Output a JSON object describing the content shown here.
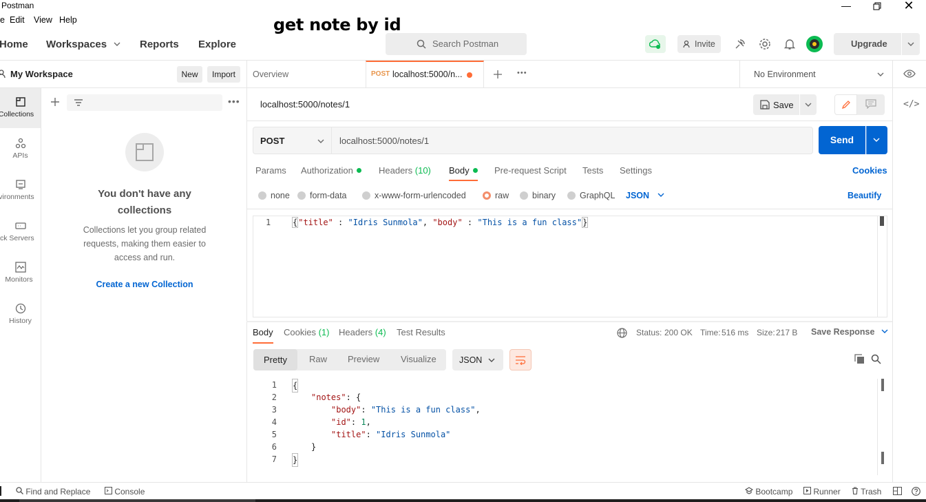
{
  "window": {
    "title": "Postman"
  },
  "menu": {
    "items": [
      "e",
      "Edit",
      "View",
      "Help"
    ]
  },
  "overlay_title": "get note by id",
  "nav": {
    "home": "Home",
    "workspaces": "Workspaces",
    "reports": "Reports",
    "explore": "Explore",
    "search_placeholder": "Search Postman",
    "invite": "Invite",
    "upgrade": "Upgrade"
  },
  "sidebar": {
    "workspace_name": "My Workspace",
    "new_label": "New",
    "import_label": "Import",
    "rail": [
      {
        "label": "Collections",
        "icon": "collections-icon"
      },
      {
        "label": "APIs",
        "icon": "apis-icon"
      },
      {
        "label": "Environments",
        "icon": "environments-icon"
      },
      {
        "label": "Mock Servers",
        "icon": "mock-servers-icon"
      },
      {
        "label": "Monitors",
        "icon": "monitors-icon"
      },
      {
        "label": "History",
        "icon": "history-icon"
      }
    ],
    "empty_title": "You don't have any collections",
    "empty_desc": "Collections let you group related requests, making them easier to access and run.",
    "create_link": "Create a new Collection"
  },
  "tabs": {
    "overview": "Overview",
    "active_method": "POST",
    "active_label": "localhost:5000/n...",
    "environment": "No Environment"
  },
  "request": {
    "title": "localhost:5000/notes/1",
    "save_label": "Save",
    "method": "POST",
    "url": "localhost:5000/notes/1",
    "send_label": "Send",
    "tabs": {
      "params": "Params",
      "authorization": "Authorization",
      "headers": "Headers",
      "headers_count": "(10)",
      "body": "Body",
      "prerequest": "Pre-request Script",
      "tests": "Tests",
      "settings": "Settings",
      "cookies": "Cookies"
    },
    "body_types": [
      "none",
      "form-data",
      "x-www-form-urlencoded",
      "raw",
      "binary",
      "GraphQL"
    ],
    "selected_body_type": "raw",
    "format": "JSON",
    "beautify": "Beautify",
    "body_line_no": "1",
    "body_parts": {
      "open": "{",
      "k1": "\"title\"",
      "colon1": " : ",
      "v1": "\"Idris Sunmola\"",
      "comma": ", ",
      "k2": "\"body\"",
      "colon2": " : ",
      "v2": "\"This is a fun class\"",
      "close": "}"
    }
  },
  "response": {
    "tabs": {
      "body": "Body",
      "cookies": "Cookies",
      "cookies_count": "(1)",
      "headers": "Headers",
      "headers_count": "(4)",
      "test_results": "Test Results"
    },
    "status_label": "Status:",
    "status_value": "200 OK",
    "time_label": "Time:",
    "time_value": "516 ms",
    "size_label": "Size:",
    "size_value": "217 B",
    "save_response": "Save Response",
    "views": [
      "Pretty",
      "Raw",
      "Preview",
      "Visualize"
    ],
    "format": "JSON",
    "lines": [
      {
        "n": "1",
        "text": "{"
      },
      {
        "n": "2",
        "key": "\"notes\"",
        "rest": ": {"
      },
      {
        "n": "3",
        "key": "\"body\"",
        "rest": ": ",
        "val": "\"This is a fun class\"",
        "tail": ","
      },
      {
        "n": "4",
        "key": "\"id\"",
        "rest": ": ",
        "num": "1",
        "tail": ","
      },
      {
        "n": "5",
        "key": "\"title\"",
        "rest": ": ",
        "val": "\"Idris Sunmola\"",
        "tail": ""
      },
      {
        "n": "6",
        "text": "}"
      },
      {
        "n": "7",
        "text": "}"
      }
    ]
  },
  "statusbar": {
    "find_replace": "Find and Replace",
    "console": "Console",
    "bootcamp": "Bootcamp",
    "runner": "Runner",
    "trash": "Trash"
  },
  "colors": {
    "accent": "#ff6c37",
    "primary": "#0265d2",
    "success": "#0cbb52"
  }
}
